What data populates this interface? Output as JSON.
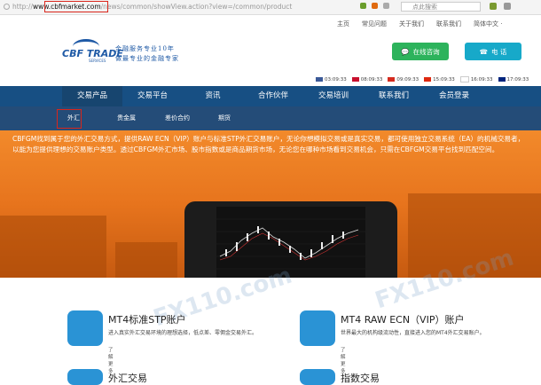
{
  "browser": {
    "url_prefix": "http://",
    "url_domain": "www.cbfmarket.com",
    "url_path": "/news/common/showView.action?view=/common/product",
    "search_placeholder": "点此搜索"
  },
  "topnav": [
    "主页",
    "常见问题",
    "关于我们",
    "联系我们",
    "简体中文 ·"
  ],
  "logo": {
    "text": "CBF TRADE",
    "sub": "SERVICES"
  },
  "slogan": [
    "金融服务专业10年",
    "做最专业的金融专家"
  ],
  "buttons": {
    "consult": "在线咨询",
    "phone": "电 话"
  },
  "clocks": [
    {
      "time": "03:09:33",
      "flag": "#3b5998"
    },
    {
      "time": "08:09:33",
      "flag": "#c8102e"
    },
    {
      "time": "09:09:33",
      "flag": "#d52b1e"
    },
    {
      "time": "15:09:33",
      "flag": "#de2910"
    },
    {
      "time": "16:09:33",
      "flag": "#bc002d"
    },
    {
      "time": "17:09:33",
      "flag": "#00247d"
    }
  ],
  "mainnav": [
    "交易产品",
    "交易平台",
    "资讯",
    "合作伙伴",
    "交易培训",
    "联系我们",
    "会员登录"
  ],
  "subnav": [
    "外汇",
    "贵金属",
    "差价合约",
    "期货"
  ],
  "banner_text": "CBFGM找到属于您的外汇交易方式，提供RAW ECN（VIP）账户与标准STP外汇交易账户，无论你想模拟交易或是真实交易，都可使用独立交易系统（EA）的机械交易者，以能为您提供理想的交易账户类型。透过CBFGM外汇市场、股市指数或是商品期货市场，无论您在哪种市场看到交易机会，只需在CBFGM交易平台找到匹配空间。",
  "cards": [
    {
      "title": "MT4标准STP账户",
      "desc": "进入真实外汇交易环境的理想选择，低点差、零佣金交易外汇。",
      "more": "了解更多"
    },
    {
      "title": "MT4 RAW ECN（VIP）账户",
      "desc": "世界最大的机构级流动性，直接进入您的MT4外汇交易账户。",
      "more": "了解更多"
    },
    {
      "title": "外汇交易",
      "desc": "",
      "more": ""
    },
    {
      "title": "指数交易",
      "desc": "",
      "more": ""
    }
  ],
  "watermark": "FX110.com"
}
